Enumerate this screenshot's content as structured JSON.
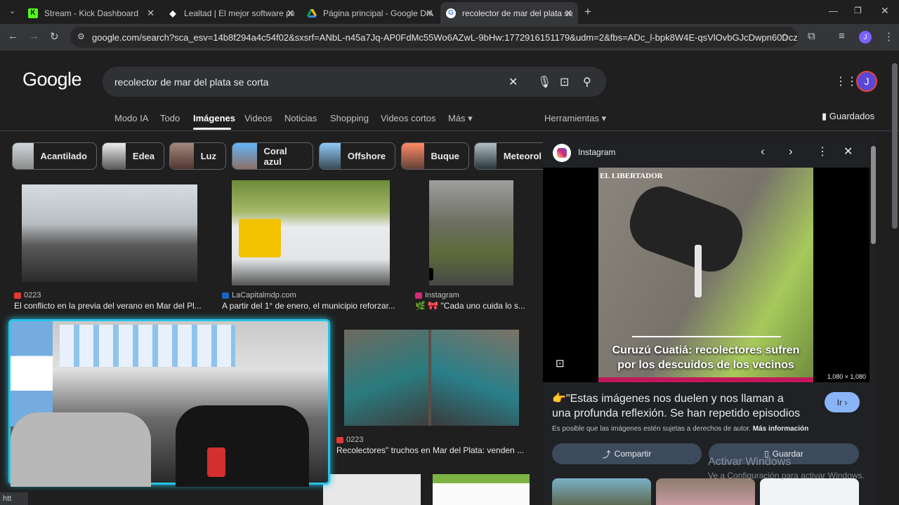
{
  "tabs": [
    {
      "title": "Stream - Kick Dashboard",
      "icon": "kick-icon",
      "color": "#53fc18"
    },
    {
      "title": "Lealtad | El mejor software para",
      "icon": "lealtad-icon",
      "color": "#ffffff"
    },
    {
      "title": "Página principal - Google Drive",
      "icon": "drive-icon",
      "color": "#1a73e8"
    },
    {
      "title": "recolector de mar del plata se c",
      "icon": "google-icon",
      "color": "#ffffff"
    }
  ],
  "url": "google.com/search?sca_esv=14b8f294a4c54f02&sxsrf=ANbL-n45a7Jq-AP0FdMc55Wo6AZwL-9bHw:1772916151179&udm=2&fbs=ADc_l-bpk8W4E-qsVlOvbGJcDwpn60DczFdcvPnuv8W...",
  "search": {
    "logo": "Google",
    "query": "recolector de mar del plata se corta"
  },
  "nav": [
    "Modo IA",
    "Todo",
    "Imágenes",
    "Videos",
    "Noticias",
    "Shopping",
    "Videos cortos",
    "Más ▾"
  ],
  "tools": "Herramientas ▾",
  "saved": "Guardados",
  "chips": [
    "Acantilado",
    "Edea",
    "Luz",
    "Coral azul",
    "Offshore",
    "Buque",
    "Meteorol"
  ],
  "results": [
    {
      "source": "0223",
      "title": "El conflicto en la previa del verano en Mar del Pl..."
    },
    {
      "source": "LaCapitalmdp.com",
      "title": "A partir del 1° de enero, el municipio reforzar..."
    },
    {
      "source": "Instagram",
      "title": "🌿 🎀 \"Cada uno cuida lo s..."
    },
    {
      "source": "0223",
      "title": "Recolectores\" truchos en Mar del Plata: venden ..."
    }
  ],
  "panel": {
    "source": "Instagram",
    "watermark": "EL LIBERTADOR",
    "overlay": "Curuzú Cuatiá: recolectores sufren por los descuidos de los vecinos",
    "dims": "1,080 × 1,080",
    "title": "👉\"Estas imágenes nos duelen y nos llaman a una profunda reflexión. Se han repetido episodios de...",
    "go": "Ir ›",
    "copyright": "Es posible que las imágenes estén sujetas a derechos de autor.",
    "more": "Más información",
    "share": "Compartir",
    "save": "Guardar"
  },
  "activate": {
    "line1": "Activar Windows",
    "line2": "Ve a Configuración para activar Windows."
  },
  "status": "htt",
  "profile": "J"
}
